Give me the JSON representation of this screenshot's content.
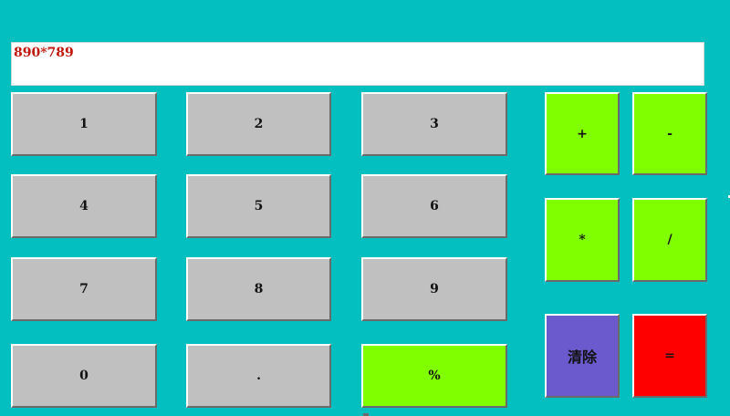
{
  "display": {
    "text": "890*789"
  },
  "keys": {
    "k1": "1",
    "k2": "2",
    "k3": "3",
    "k4": "4",
    "k5": "5",
    "k6": "6",
    "k7": "7",
    "k8": "8",
    "k9": "9",
    "k0": "0",
    "dot": ".",
    "percent": "%",
    "plus": "+",
    "minus": "-",
    "multiply": "*",
    "divide": "/",
    "clear": "清除",
    "equals": "="
  },
  "colors": {
    "background": "#03BFBF",
    "digit_key": "#C0C0C0",
    "operator_key": "#80FF00",
    "clear_key": "#6A5ACD",
    "equals_key": "#FF0000",
    "display_text": "#C0180F"
  }
}
